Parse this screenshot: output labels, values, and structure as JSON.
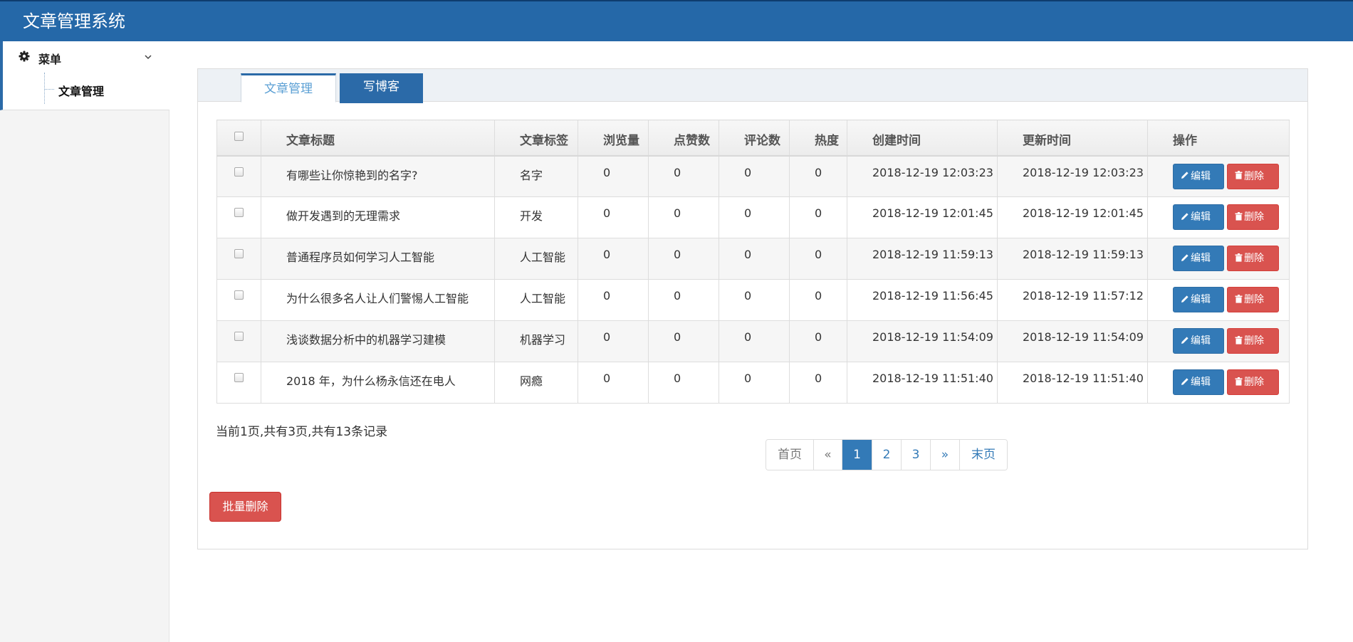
{
  "app": {
    "title": "文章管理系统"
  },
  "sidebar": {
    "menu_label": "菜单",
    "menu_icon": "gear-icon",
    "items": [
      {
        "label": "文章管理"
      }
    ]
  },
  "tabs": [
    {
      "label": "文章管理",
      "active": true
    },
    {
      "label": "写博客",
      "active": false
    }
  ],
  "table": {
    "headers": [
      "文章标题",
      "文章标签",
      "浏览量",
      "点赞数",
      "评论数",
      "热度",
      "创建时间",
      "更新时间",
      "操作"
    ],
    "rows": [
      {
        "title": "有哪些让你惊艳到的名字?",
        "tag": "名字",
        "views": "0",
        "likes": "0",
        "comments": "0",
        "heat": "0",
        "created": "2018-12-19 12:03:23",
        "updated": "2018-12-19 12:03:23"
      },
      {
        "title": "做开发遇到的无理需求",
        "tag": "开发",
        "views": "0",
        "likes": "0",
        "comments": "0",
        "heat": "0",
        "created": "2018-12-19 12:01:45",
        "updated": "2018-12-19 12:01:45"
      },
      {
        "title": "普通程序员如何学习人工智能",
        "tag": "人工智能",
        "views": "0",
        "likes": "0",
        "comments": "0",
        "heat": "0",
        "created": "2018-12-19 11:59:13",
        "updated": "2018-12-19 11:59:13"
      },
      {
        "title": "为什么很多名人让人们警惕人工智能",
        "tag": "人工智能",
        "views": "0",
        "likes": "0",
        "comments": "0",
        "heat": "0",
        "created": "2018-12-19 11:56:45",
        "updated": "2018-12-19 11:57:12"
      },
      {
        "title": "浅谈数据分析中的机器学习建模",
        "tag": "机器学习",
        "views": "0",
        "likes": "0",
        "comments": "0",
        "heat": "0",
        "created": "2018-12-19 11:54:09",
        "updated": "2018-12-19 11:54:09"
      },
      {
        "title": "2018 年，为什么杨永信还在电人",
        "tag": "网瘾",
        "views": "0",
        "likes": "0",
        "comments": "0",
        "heat": "0",
        "created": "2018-12-19 11:51:40",
        "updated": "2018-12-19 11:51:40"
      }
    ],
    "edit_label": "编辑",
    "delete_label": "删除"
  },
  "summary": "当前1页,共有3页,共有13条记录",
  "pager": {
    "first": "首页",
    "prev": "«",
    "pages": [
      "1",
      "2",
      "3"
    ],
    "current": "1",
    "next": "»",
    "last": "末页"
  },
  "bulk_delete_label": "批量删除",
  "colors": {
    "header_bg": "#2568a8",
    "primary": "#337ab7",
    "danger": "#d9534f"
  }
}
